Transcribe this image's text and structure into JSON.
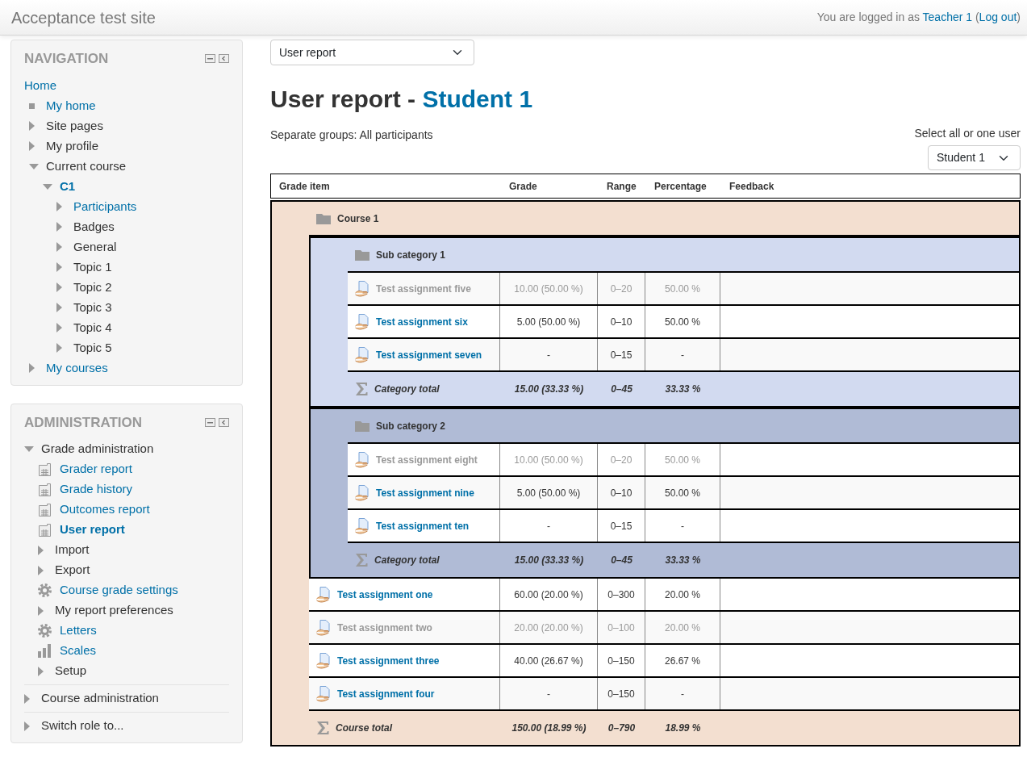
{
  "header": {
    "site_title": "Acceptance test site",
    "login": {
      "before": "You are logged in as",
      "user": "Teacher 1",
      "between": "(",
      "logout": "Log out",
      "after": ")"
    }
  },
  "navigation": {
    "title": "NAVIGATION",
    "items": [
      {
        "label": "Home",
        "kind": "plain",
        "link": true,
        "current": false,
        "children": [
          {
            "label": "My home",
            "kind": "leaf",
            "link": true,
            "current": false
          },
          {
            "label": "Site pages",
            "kind": "branch",
            "expanded": false,
            "link": false,
            "current": false
          },
          {
            "label": "My profile",
            "kind": "branch",
            "expanded": false,
            "link": false,
            "current": false
          },
          {
            "label": "Current course",
            "kind": "branch",
            "expanded": true,
            "link": false,
            "current": false,
            "children": [
              {
                "label": "C1",
                "kind": "branch",
                "expanded": true,
                "link": true,
                "current": true,
                "children": [
                  {
                    "label": "Participants",
                    "kind": "branch",
                    "expanded": false,
                    "link": true,
                    "current": false
                  },
                  {
                    "label": "Badges",
                    "kind": "branch",
                    "expanded": false,
                    "link": false,
                    "current": false
                  },
                  {
                    "label": "General",
                    "kind": "branch",
                    "expanded": false,
                    "link": false,
                    "current": false
                  },
                  {
                    "label": "Topic 1",
                    "kind": "branch",
                    "expanded": false,
                    "link": false,
                    "current": false
                  },
                  {
                    "label": "Topic 2",
                    "kind": "branch",
                    "expanded": false,
                    "link": false,
                    "current": false
                  },
                  {
                    "label": "Topic 3",
                    "kind": "branch",
                    "expanded": false,
                    "link": false,
                    "current": false
                  },
                  {
                    "label": "Topic 4",
                    "kind": "branch",
                    "expanded": false,
                    "link": false,
                    "current": false
                  },
                  {
                    "label": "Topic 5",
                    "kind": "branch",
                    "expanded": false,
                    "link": false,
                    "current": false
                  }
                ]
              }
            ]
          },
          {
            "label": "My courses",
            "kind": "branch",
            "expanded": false,
            "link": true,
            "current": false
          }
        ]
      }
    ]
  },
  "administration": {
    "title": "ADMINISTRATION",
    "items": [
      {
        "label": "Grade administration",
        "kind": "branch",
        "expanded": true,
        "link": false,
        "current": false,
        "children": [
          {
            "label": "Grader report",
            "kind": "report",
            "link": true,
            "current": false
          },
          {
            "label": "Grade history",
            "kind": "report",
            "link": true,
            "current": false
          },
          {
            "label": "Outcomes report",
            "kind": "report",
            "link": true,
            "current": false
          },
          {
            "label": "User report",
            "kind": "report",
            "link": true,
            "current": true
          },
          {
            "label": "Import",
            "kind": "branch",
            "expanded": false,
            "link": false,
            "current": false
          },
          {
            "label": "Export",
            "kind": "branch",
            "expanded": false,
            "link": false,
            "current": false
          },
          {
            "label": "Course grade settings",
            "kind": "settings",
            "link": true,
            "current": false
          },
          {
            "label": "My report preferences",
            "kind": "branch",
            "expanded": false,
            "link": false,
            "current": false
          },
          {
            "label": "Letters",
            "kind": "settings",
            "link": true,
            "current": false
          },
          {
            "label": "Scales",
            "kind": "scales",
            "link": true,
            "current": false
          },
          {
            "label": "Setup",
            "kind": "branch",
            "expanded": false,
            "link": false,
            "current": false
          }
        ]
      },
      {
        "label": "Course administration",
        "kind": "branch",
        "expanded": false,
        "link": false,
        "current": false
      },
      {
        "label": "Switch role to...",
        "kind": "branch",
        "expanded": false,
        "link": false,
        "current": false
      }
    ]
  },
  "report": {
    "report_select": "User report",
    "heading": {
      "text": "User report -",
      "link": "Student 1"
    },
    "groups": "Separate groups: All participants",
    "user_select": {
      "label": "Select all or one user",
      "value": "Student 1"
    },
    "table": {
      "columns": [
        "Grade item",
        "Grade",
        "Range",
        "Percentage",
        "Feedback"
      ],
      "course": {
        "kind": "category",
        "name": "Course 1",
        "color": "#f3dfd0",
        "children": [
          {
            "kind": "category",
            "name": "Sub category 1",
            "color": "#d2daf0",
            "children": [
              {
                "kind": "item",
                "name": "Test assignment five",
                "hidden": true,
                "grade": "10.00 (50.00 %)",
                "range": "0–20",
                "percentage": "50.00 %"
              },
              {
                "kind": "item",
                "name": "Test assignment six",
                "hidden": false,
                "grade": "5.00 (50.00 %)",
                "range": "0–10",
                "percentage": "50.00 %"
              },
              {
                "kind": "item",
                "name": "Test assignment seven",
                "hidden": false,
                "grade": "-",
                "range": "0–15",
                "percentage": "-"
              }
            ],
            "total": {
              "label": "Category total",
              "grade": "15.00 (33.33 %)",
              "range": "0–45",
              "percentage": "33.33 %"
            }
          },
          {
            "kind": "category",
            "name": "Sub category 2",
            "color": "#b0bbd6",
            "children": [
              {
                "kind": "item",
                "name": "Test assignment eight",
                "hidden": true,
                "grade": "10.00 (50.00 %)",
                "range": "0–20",
                "percentage": "50.00 %"
              },
              {
                "kind": "item",
                "name": "Test assignment nine",
                "hidden": false,
                "grade": "5.00 (50.00 %)",
                "range": "0–10",
                "percentage": "50.00 %"
              },
              {
                "kind": "item",
                "name": "Test assignment ten",
                "hidden": false,
                "grade": "-",
                "range": "0–15",
                "percentage": "-"
              }
            ],
            "total": {
              "label": "Category total",
              "grade": "15.00 (33.33 %)",
              "range": "0–45",
              "percentage": "33.33 %"
            }
          },
          {
            "kind": "item",
            "name": "Test assignment one",
            "hidden": false,
            "grade": "60.00 (20.00 %)",
            "range": "0–300",
            "percentage": "20.00 %"
          },
          {
            "kind": "item",
            "name": "Test assignment two",
            "hidden": true,
            "grade": "20.00 (20.00 %)",
            "range": "0–100",
            "percentage": "20.00 %"
          },
          {
            "kind": "item",
            "name": "Test assignment three",
            "hidden": false,
            "grade": "40.00 (26.67 %)",
            "range": "0–150",
            "percentage": "26.67 %"
          },
          {
            "kind": "item",
            "name": "Test assignment four",
            "hidden": false,
            "grade": "-",
            "range": "0–150",
            "percentage": "-"
          }
        ],
        "total": {
          "label": "Course total",
          "grade": "150.00 (18.99 %)",
          "range": "0–790",
          "percentage": "18.99 %"
        }
      }
    }
  }
}
